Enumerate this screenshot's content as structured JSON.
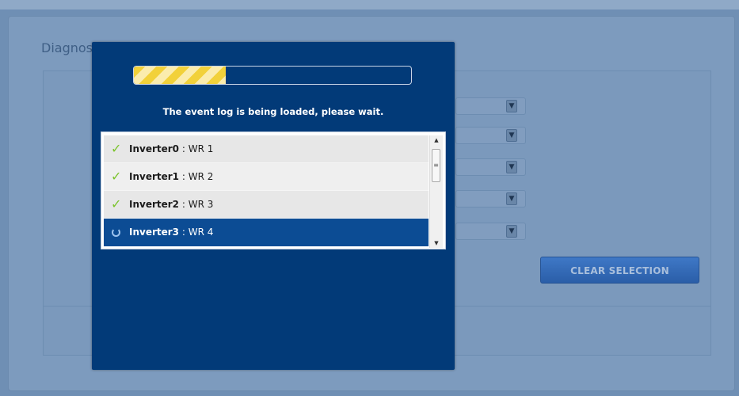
{
  "page": {
    "panel_title": "Diagnostics",
    "clear_button_label": "CLEAR SELECTION",
    "select_count": 5
  },
  "modal": {
    "progress_fraction": 0.33,
    "status_text": "The event log is being loaded, please wait.",
    "items": [
      {
        "name": "Inverter0",
        "label": "WR 1",
        "state": "done"
      },
      {
        "name": "Inverter1",
        "label": "WR 2",
        "state": "done"
      },
      {
        "name": "Inverter2",
        "label": "WR 3",
        "state": "done"
      },
      {
        "name": "Inverter3",
        "label": "WR 4",
        "state": "loading"
      }
    ],
    "separator": " : ",
    "icons": {
      "done": "check-icon",
      "loading": "spinner-icon"
    }
  },
  "colors": {
    "modal_bg": "#023a78",
    "active_row": "#0c4c94",
    "check": "#7cc42d",
    "progress_stripe": "#f2d13a",
    "button": "#2f69b6"
  }
}
